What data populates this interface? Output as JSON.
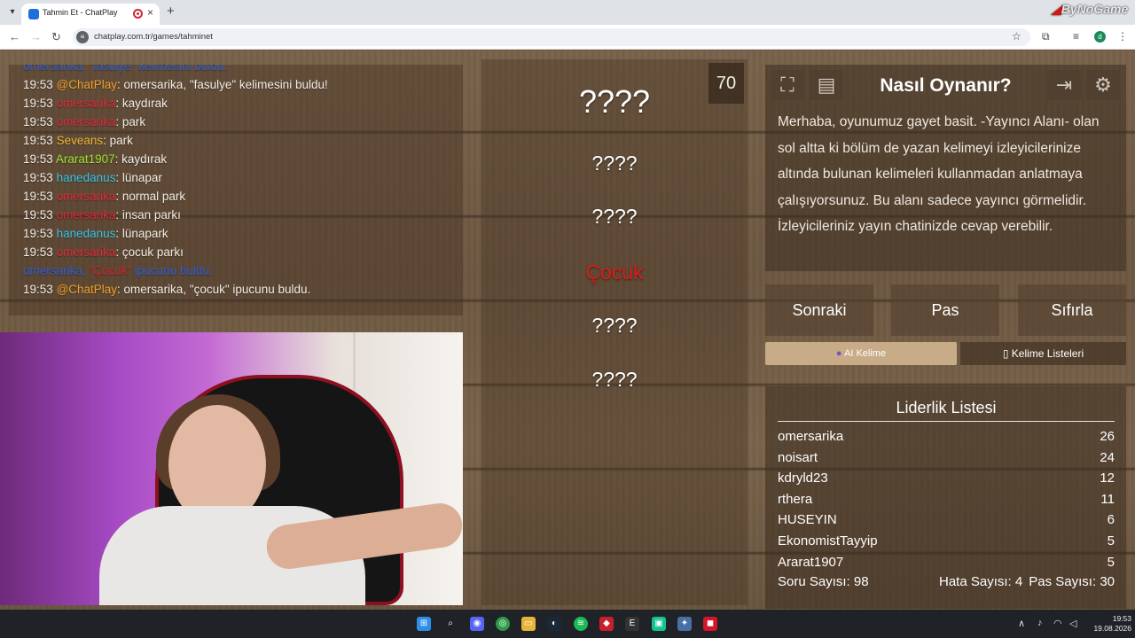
{
  "browser": {
    "tab_title": "Tahmin Et - ChatPlay",
    "url": "chatplay.com.tr/games/tahminet",
    "brand_overlay": "ByNoGame",
    "profile_letter": "d"
  },
  "chat": {
    "lines": [
      {
        "time": "",
        "user": "omersarika,",
        "text": "\"fasulye\" kelimesini buldu.",
        "user_color": "#2e5fd8",
        "notice": true
      },
      {
        "time": "19:53",
        "user": "@ChatPlay",
        "text": ": omersarika, \"fasulye\" kelimesini buldu!",
        "user_color": "#f0a02a"
      },
      {
        "time": "19:53",
        "user": "omersarika",
        "text": ": kaydırak",
        "user_color": "#e0283a"
      },
      {
        "time": "19:53",
        "user": "omersarika",
        "text": ": park",
        "user_color": "#e0283a"
      },
      {
        "time": "19:53",
        "user": "Seveans",
        "text": ": park",
        "user_color": "#e9b83a"
      },
      {
        "time": "19:53",
        "user": "Ararat1907",
        "text": ": kaydırak",
        "user_color": "#9be52e"
      },
      {
        "time": "19:53",
        "user": "hanedanus",
        "text": ": lünapar",
        "user_color": "#36c4e6"
      },
      {
        "time": "19:53",
        "user": "omersarika",
        "text": ": normal park",
        "user_color": "#e0283a"
      },
      {
        "time": "19:53",
        "user": "omersarika",
        "text": ": insan parkı",
        "user_color": "#e0283a"
      },
      {
        "time": "19:53",
        "user": "hanedanus",
        "text": ": lünapark",
        "user_color": "#36c4e6"
      },
      {
        "time": "19:53",
        "user": "omersarika",
        "text": ": çocuk parkı",
        "user_color": "#e0283a"
      },
      {
        "time": "",
        "user": "omersarika,",
        "word": "\"Çocuk\"",
        "text": " ipucunu buldu.",
        "user_color": "#2e5fd8",
        "notice": true
      },
      {
        "time": "19:53",
        "user": "@ChatPlay",
        "text": ": omersarika, \"çocuk\" ipucunu buldu.",
        "user_color": "#f0a02a"
      }
    ]
  },
  "board": {
    "timer": "70",
    "main_word": "????",
    "hints": [
      "????",
      "????",
      "Çocuk",
      "????",
      "????"
    ]
  },
  "howto": {
    "title": "Nasıl Oynanır?",
    "text": "Merhaba, oyunumuz gayet basit. -Yayıncı Alanı- olan sol altta ki bölüm de yazan kelimeyi izleyicilerinize altında bulunan kelimeleri kullanmadan anlatmaya çalışıyorsunuz. Bu alanı sadece yayıncı görmelidir. İzleyicileriniz yayın chatinizde cevap verebilir."
  },
  "buttons": {
    "next": "Sonraki",
    "pass": "Pas",
    "reset": "Sıfırla",
    "ai_word": "AI Kelime",
    "word_lists": "Kelime Listeleri"
  },
  "leaderboard": {
    "title": "Liderlik Listesi",
    "rows": [
      {
        "name": "omersarika",
        "score": "26"
      },
      {
        "name": "noisart",
        "score": "24"
      },
      {
        "name": "kdryld23",
        "score": "12"
      },
      {
        "name": "rthera",
        "score": "11"
      },
      {
        "name": "HUSEYIN",
        "score": "6"
      },
      {
        "name": "EkonomistTayyip",
        "score": "5"
      },
      {
        "name": "Ararat1907",
        "score": "5"
      }
    ],
    "questions_label": "Soru Sayısı: 98",
    "errors_label": "Hata Sayısı: 4",
    "passes_label": "Pas Sayısı: 30"
  },
  "taskbar": {
    "time": "19:53",
    "date": "19.08.2026"
  }
}
